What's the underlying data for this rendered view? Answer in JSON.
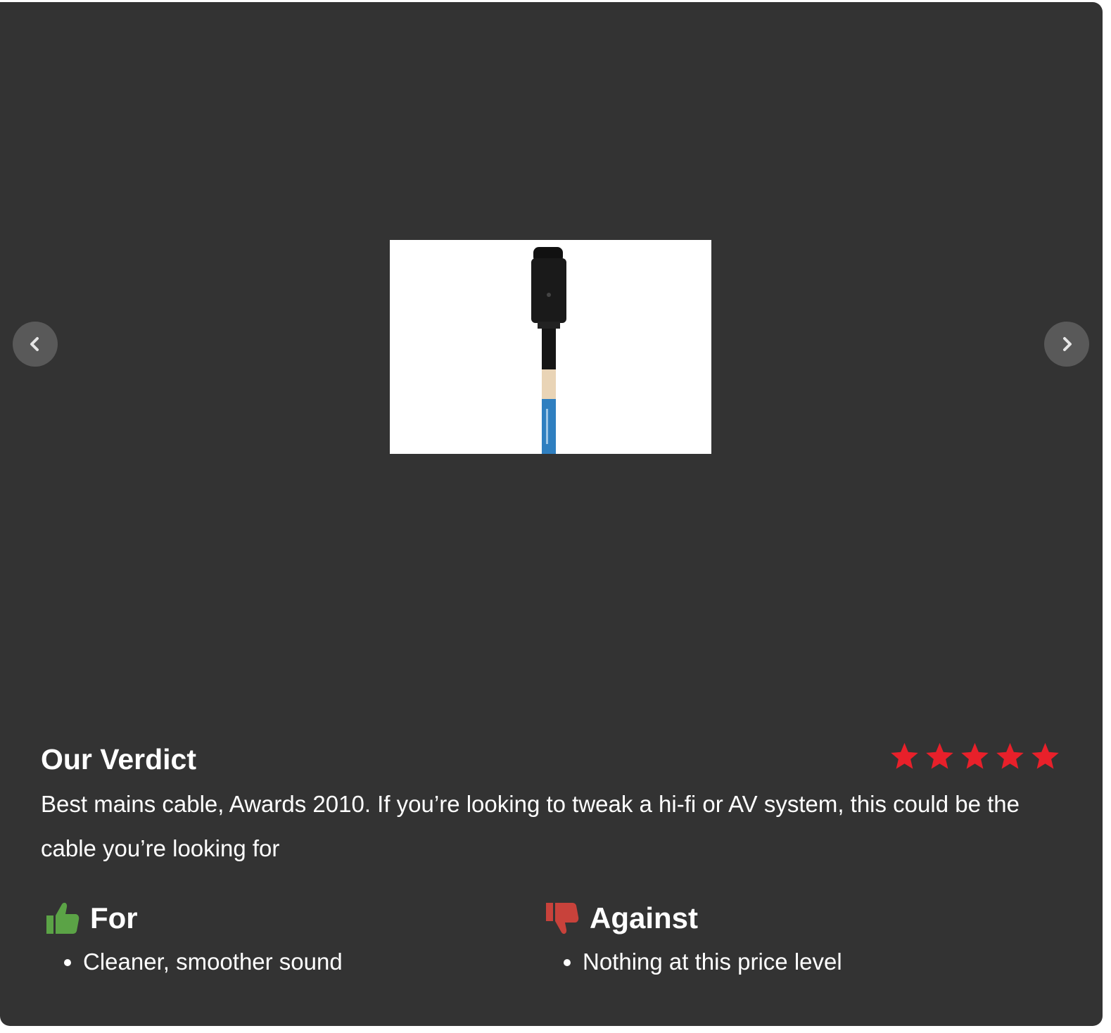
{
  "gallery": {
    "image_alt": "mains cable",
    "prev_icon": "chevron-left-icon",
    "next_icon": "chevron-right-icon"
  },
  "verdict": {
    "title": "Our Verdict",
    "rating": 5,
    "rating_max": 5,
    "star_color": "#e8202a",
    "text": "Best mains cable, Awards 2010. If you’re looking to tweak a hi-fi or AV system, this could be the cable you’re looking for"
  },
  "for": {
    "title": "For",
    "icon": "thumbs-up-icon",
    "icon_color": "#5ba346",
    "items": [
      "Cleaner, smoother sound"
    ]
  },
  "against": {
    "title": "Against",
    "icon": "thumbs-down-icon",
    "icon_color": "#c8423b",
    "items": [
      "Nothing at this price level"
    ]
  }
}
